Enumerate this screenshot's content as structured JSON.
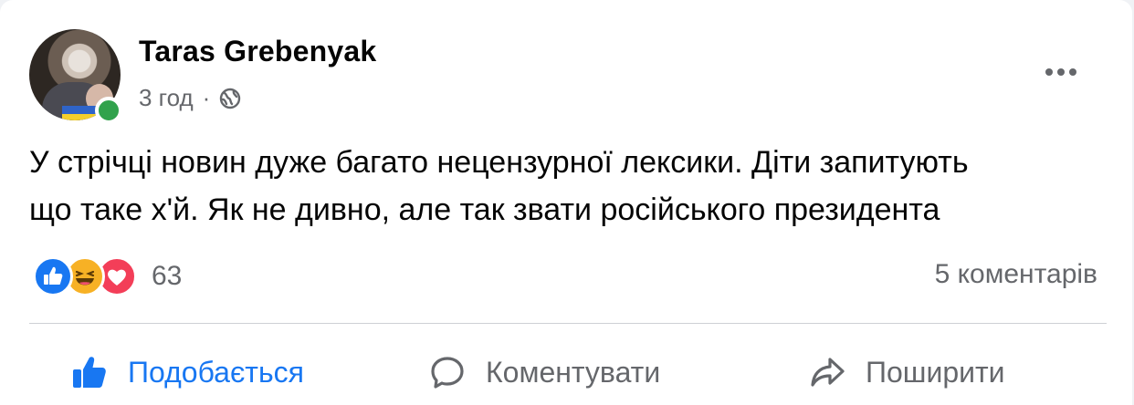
{
  "post": {
    "author": "Taras Grebenyak",
    "time": "3 год",
    "separator": "·",
    "privacy_icon": "globe-icon",
    "text_line1": "У стрічці новин дуже багато нецензурної лексики. Діти запитують",
    "text_line2": "що таке х'й. Як не дивно, але так звати російського президента"
  },
  "reactions": {
    "icons": [
      "like-reaction-icon",
      "haha-reaction-icon",
      "love-reaction-icon"
    ],
    "count": "63"
  },
  "comments": {
    "label": "5 коментарів"
  },
  "actions": {
    "like": "Подобається",
    "comment": "Коментувати",
    "share": "Поширити"
  },
  "colors": {
    "accent": "#1877f2",
    "secondary_text": "#65676b",
    "online": "#31a24c",
    "love": "#f33e58",
    "haha": "#f7b125"
  }
}
